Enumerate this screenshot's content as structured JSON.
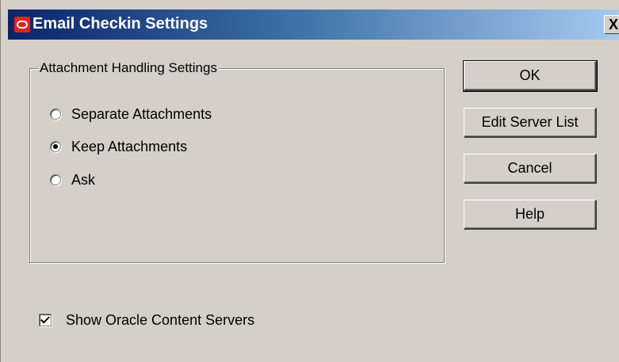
{
  "window": {
    "title": "Email Checkin Settings",
    "logo_icon": "oracle-logo-icon",
    "close_label": "X"
  },
  "attachment_group": {
    "legend": "Attachment Handling Settings",
    "options": [
      {
        "label": "Separate Attachments",
        "checked": false
      },
      {
        "label": "Keep Attachments",
        "checked": true
      },
      {
        "label": "Ask",
        "checked": false
      }
    ]
  },
  "buttons": {
    "ok": "OK",
    "edit_server_list": "Edit Server List",
    "cancel": "Cancel",
    "help": "Help"
  },
  "show_servers": {
    "label": "Show Oracle Content Servers",
    "checked": true
  },
  "colors": {
    "face": "#d4d0c8",
    "title_start": "#0a246a",
    "title_end": "#a6caf0",
    "logo_red": "#e5211b"
  }
}
